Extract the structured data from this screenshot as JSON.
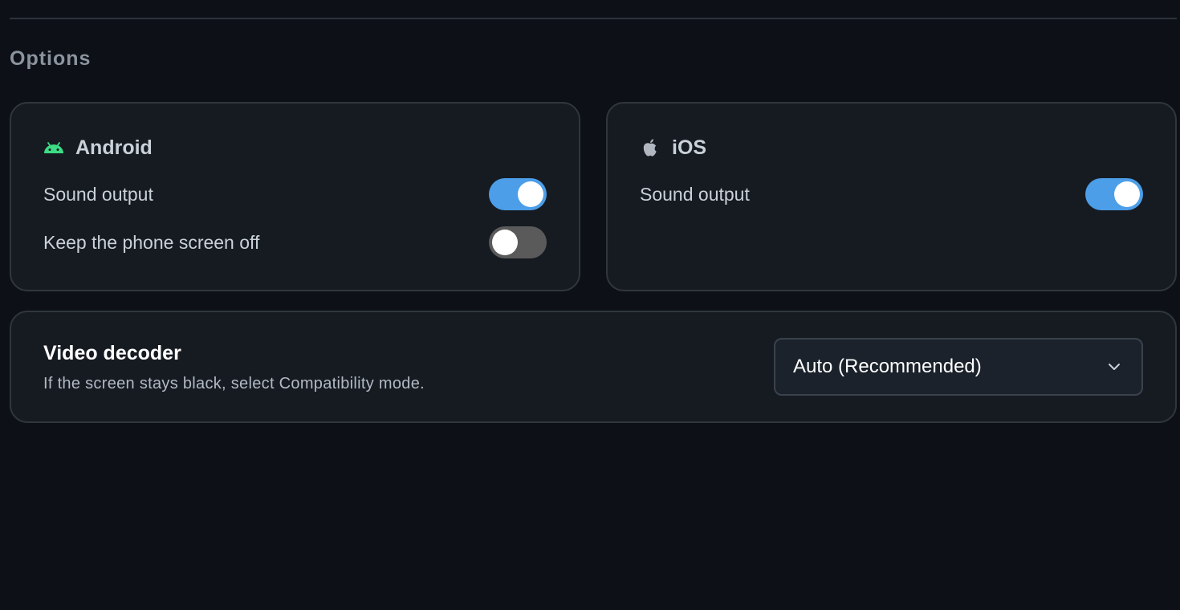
{
  "section": {
    "title": "Options"
  },
  "android": {
    "name": "Android",
    "icon": "android-icon",
    "icon_color": "#3ddc84",
    "settings": [
      {
        "label": "Sound output",
        "enabled": true
      },
      {
        "label": "Keep the phone screen off",
        "enabled": false
      }
    ]
  },
  "ios": {
    "name": "iOS",
    "icon": "apple-icon",
    "icon_color": "#b1b7bf",
    "settings": [
      {
        "label": "Sound output",
        "enabled": true
      }
    ]
  },
  "video_decoder": {
    "title": "Video decoder",
    "description": "If the screen stays black, select Compatibility mode.",
    "selected": "Auto (Recommended)"
  },
  "colors": {
    "background": "#0d1117",
    "card": "#161b22",
    "toggle_on": "#4c9ee8",
    "toggle_off": "#5a5a5a"
  }
}
